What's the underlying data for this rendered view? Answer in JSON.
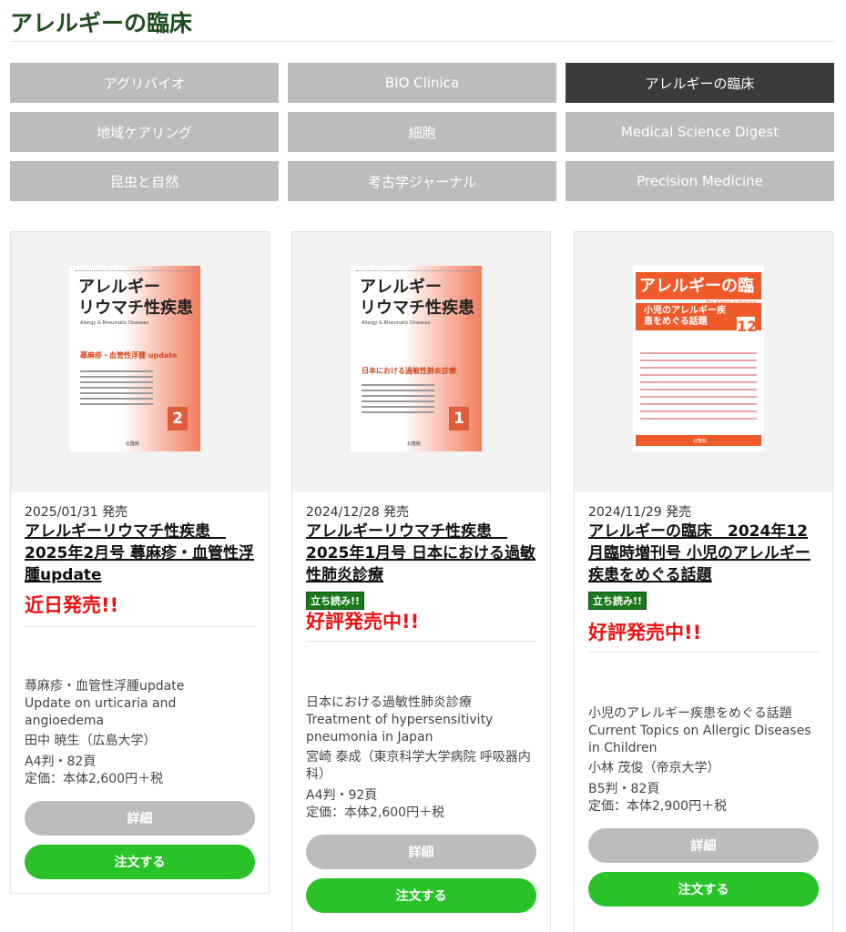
{
  "page_title": "アレルギーの臨床",
  "nav": [
    {
      "label": "アグリバイオ",
      "active": false
    },
    {
      "label": "BIO Clinica",
      "active": false
    },
    {
      "label": "アレルギーの臨床",
      "active": true
    },
    {
      "label": "地域ケアリング",
      "active": false
    },
    {
      "label": "細胞",
      "active": false
    },
    {
      "label": "Medical Science Digest",
      "active": false
    },
    {
      "label": "昆虫と自然",
      "active": false
    },
    {
      "label": "考古学ジャーナル",
      "active": false
    },
    {
      "label": "Precision Medicine",
      "active": false
    }
  ],
  "cards": [
    {
      "cover": {
        "title_line1": "アレルギー",
        "title_line2": "リウマチ性疾患",
        "subtitle": "Allergy & Rheumatic Diseases",
        "feature": "蕁麻疹・血管性浮腫 update",
        "number": "2",
        "publisher": "北隆館"
      },
      "date": "2025/01/31 発売",
      "title": "アレルギーリウマチ性疾患　2025年2月号 蕁麻疹・血管性浮腫update",
      "badge": "",
      "status": "近日発売!!",
      "desc_ja": "蕁麻疹・血管性浮腫update",
      "desc_en": "Update on urticaria and angioedema",
      "author": "田中 暁生（広島大学）",
      "size": "A4判・82頁",
      "price": "定価：本体2,600円＋税",
      "detail_label": "詳細",
      "order_label": "注文する"
    },
    {
      "cover": {
        "title_line1": "アレルギー",
        "title_line2": "リウマチ性疾患",
        "subtitle": "Allergy & Rheumatic Diseases",
        "feature": "日本における過敏性肺炎診療",
        "number": "1",
        "publisher": "北隆館"
      },
      "date": "2024/12/28 発売",
      "title": "アレルギーリウマチ性疾患　2025年1月号 日本における過敏性肺炎診療",
      "badge": "立ち読み!!",
      "status": "好評発売中!!",
      "desc_ja": "日本における過敏性肺炎診療",
      "desc_en": "Treatment of hypersensitivity pneumonia in Japan",
      "author": "宮崎 泰成（東京科学大学病院 呼吸器内科）",
      "size": "A4判・92頁",
      "price": "定価：本体2,600円＋税",
      "detail_label": "詳細",
      "order_label": "注文する"
    },
    {
      "cover": {
        "title": "アレルギーの臨床",
        "subtitle": "The Allergy in Practice",
        "feature": "小児のアレルギー疾患をめぐる話題",
        "number": "12",
        "publisher": "北隆館"
      },
      "date": "2024/11/29 発売",
      "title": "アレルギーの臨床　2024年12月臨時増刊号 小児のアレルギー疾患をめぐる話題",
      "badge": "立ち読み!!",
      "status": "好評発売中!!",
      "desc_ja": "小児のアレルギー疾患をめぐる話題",
      "desc_en": "Current Topics on Allergic Diseases in Children",
      "author": "小林 茂俊（帝京大学）",
      "size": "B5判・82頁",
      "price": "定価：本体2,900円＋税",
      "detail_label": "詳細",
      "order_label": "注文する"
    }
  ],
  "colors": {
    "brand_title": "#1f4d1f",
    "nav_inactive": "#bcbcbc",
    "nav_active": "#3b3b3b",
    "status_red": "#ee1111",
    "order_green": "#29c229",
    "badge_green": "#1c7a1c"
  }
}
